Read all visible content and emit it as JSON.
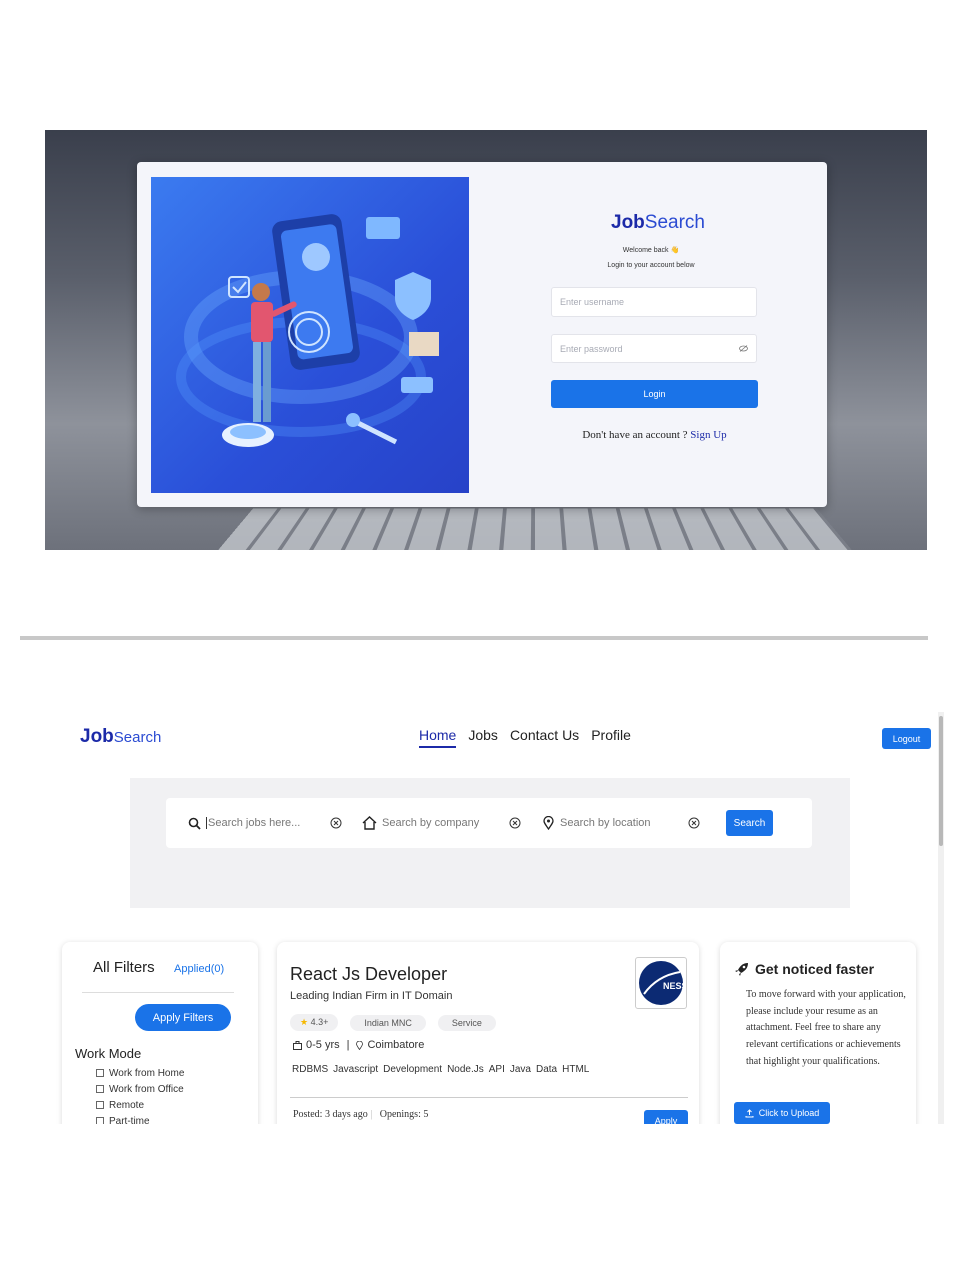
{
  "login": {
    "brand_bold": "Job",
    "brand_light": "Search",
    "welcome": "Welcome back 👋",
    "subtitle": "Login to your account below",
    "username_placeholder": "Enter username",
    "password_placeholder": "Enter password",
    "login_label": "Login",
    "signup_prompt": "Don't have an account ?",
    "signup_link": "Sign Up"
  },
  "header": {
    "brand_bold": "Job",
    "brand_light": "Search",
    "nav": [
      "Home",
      "Jobs",
      "Contact Us",
      "Profile"
    ],
    "active_nav": "Home",
    "logout_label": "Logout"
  },
  "search": {
    "jobs_placeholder": "Search jobs here...",
    "company_placeholder": "Search by company",
    "location_placeholder": "Search by location",
    "search_label": "Search"
  },
  "filters": {
    "title": "All Filters",
    "applied": "Applied(0)",
    "apply_label": "Apply Filters",
    "work_mode_title": "Work Mode",
    "work_modes": [
      "Work from Home",
      "Work from Office",
      "Remote",
      "Part-time"
    ]
  },
  "job": {
    "title": "React Js Developer",
    "company": "Leading Indian Firm in IT Domain",
    "rating": "4.3+",
    "tags": [
      "Indian MNC",
      "Service"
    ],
    "experience": "0-5 yrs",
    "location": "Coimbatore",
    "skills": [
      "RDBMS",
      "Javascript",
      "Development",
      "Node.Js",
      "API",
      "Java",
      "Data",
      "HTML"
    ],
    "posted": "Posted: 3 days ago",
    "openings": "Openings: 5",
    "apply_label": "Apply",
    "logo_text": "NESS"
  },
  "notice": {
    "title": "Get noticed faster",
    "body": "To move forward with your application, please include your resume as an attachment. Feel free to share any relevant certifications or achievements that highlight your qualifications.",
    "upload_label": "Click to Upload"
  },
  "colors": {
    "primary": "#1a73e8",
    "brand": "#1c2aa8",
    "illustration": "#2a4fd8"
  }
}
